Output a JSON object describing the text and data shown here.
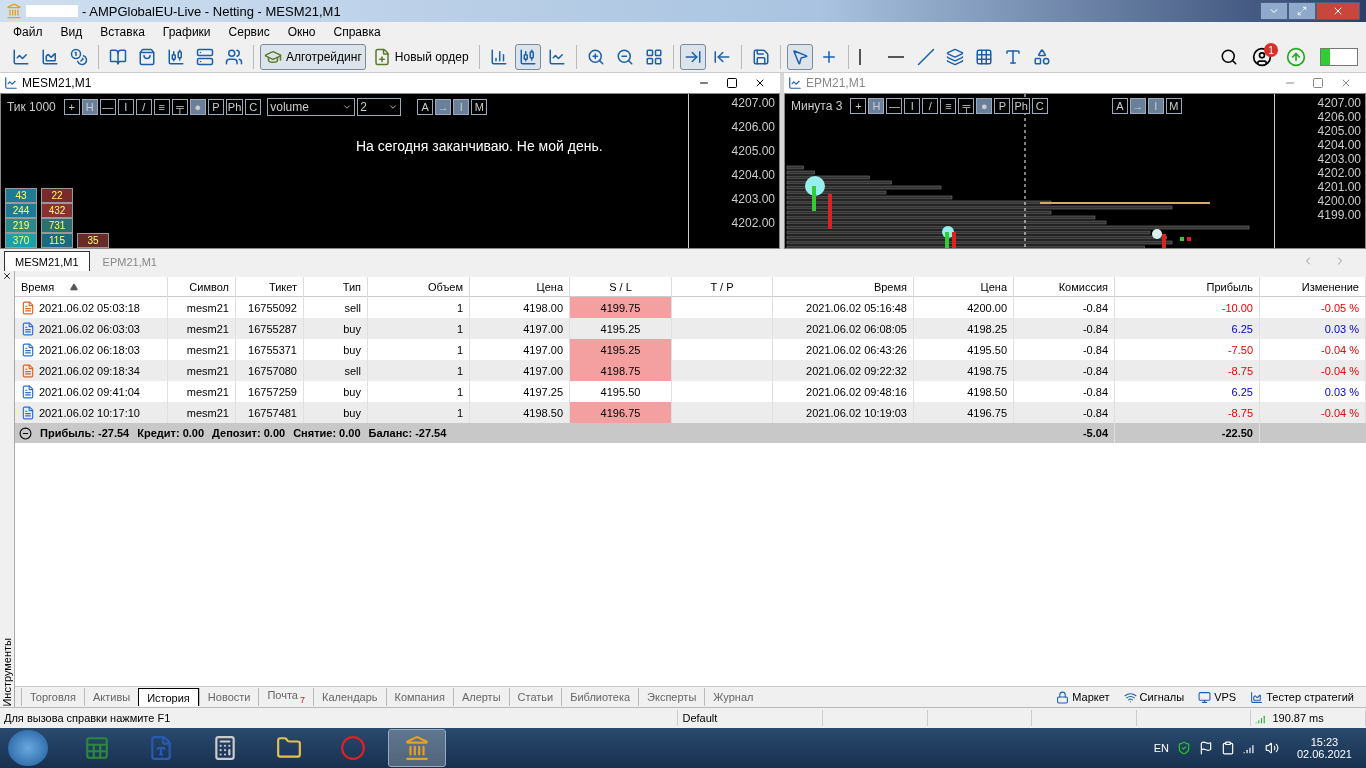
{
  "window": {
    "title": "- AMPGlobalEU-Live - Netting - MESM21,M1"
  },
  "menu": [
    "Файл",
    "Вид",
    "Вставка",
    "Графики",
    "Сервис",
    "Окно",
    "Справка"
  ],
  "toolbar": [
    {
      "kind": "button",
      "selected": false
    },
    {
      "kind": "button",
      "selected": false
    },
    {
      "kind": "button",
      "selected": false
    },
    {
      "kind": "separator"
    },
    {
      "kind": "button",
      "selected": false
    },
    {
      "kind": "button",
      "selected": false
    },
    {
      "kind": "button",
      "selected": false
    },
    {
      "kind": "button",
      "selected": false
    },
    {
      "kind": "button",
      "selected": false
    },
    {
      "kind": "separator"
    },
    {
      "kind": "labeled",
      "label": "Алготрейдинг",
      "selected": true
    },
    {
      "kind": "labeled",
      "label": "Новый ордер",
      "selected": false
    },
    {
      "kind": "separator"
    },
    {
      "kind": "button",
      "selected": false
    },
    {
      "kind": "button",
      "selected": true
    },
    {
      "kind": "button",
      "selected": false
    },
    {
      "kind": "separator"
    },
    {
      "kind": "button",
      "selected": false
    },
    {
      "kind": "button",
      "selected": false
    },
    {
      "kind": "button",
      "selected": false
    },
    {
      "kind": "separator"
    },
    {
      "kind": "button",
      "selected": true
    },
    {
      "kind": "button",
      "selected": false
    },
    {
      "kind": "separator"
    },
    {
      "kind": "button",
      "selected": false
    },
    {
      "kind": "separator"
    },
    {
      "kind": "button",
      "selected": true
    },
    {
      "kind": "button",
      "selected": false
    },
    {
      "kind": "separator"
    },
    {
      "kind": "button",
      "selected": false
    },
    {
      "kind": "button",
      "selected": false
    },
    {
      "kind": "button",
      "selected": false
    },
    {
      "kind": "button",
      "selected": false
    },
    {
      "kind": "button",
      "selected": false
    },
    {
      "kind": "button",
      "selected": false
    },
    {
      "kind": "button",
      "selected": false
    }
  ],
  "notifications": {
    "badge": "1"
  },
  "charts": [
    {
      "title": "MESM21,M1",
      "active": true,
      "label": "Тик 1000",
      "tools": [
        "+",
        "H",
        "—",
        "I",
        "/",
        "≡",
        "╤",
        "●",
        "P",
        "Ph",
        "C"
      ],
      "indicator": "volume",
      "period": "2",
      "modes": [
        "A",
        "→",
        "I",
        "M"
      ],
      "message": "На сегодня заканчиваю. Не мой день.",
      "prices": [
        "4207.00",
        "4206.00",
        "4205.00",
        "4204.00",
        "4203.00",
        "4202.00"
      ],
      "clusters": [
        [
          {
            "value": "43",
            "color": "#1f7a96"
          },
          {
            "value": "244",
            "color": "#1f7a96"
          },
          {
            "value": "219",
            "color": "#2a8a8a"
          },
          {
            "value": "370",
            "color": "#1aa0a8"
          }
        ],
        [
          {
            "value": "22",
            "color": "#7a2a2a"
          },
          {
            "value": "432",
            "color": "#8a3030"
          },
          {
            "value": "731",
            "color": "#2a7070"
          },
          {
            "value": "115",
            "color": "#1a6a80"
          }
        ],
        [
          {
            "value": "35",
            "color": "#6a2a2a"
          }
        ]
      ]
    },
    {
      "title": "EPM21,M1",
      "active": false,
      "label": "Минута 3",
      "tools": [
        "+",
        "H",
        "—",
        "I",
        "/",
        "≡",
        "╤",
        "●",
        "P",
        "Ph",
        "C"
      ],
      "modes": [
        "A",
        "→",
        "I",
        "M"
      ],
      "prices": [
        "4207.00",
        "4206.00",
        "4205.00",
        "4204.00",
        "4203.00",
        "4202.00",
        "4201.00",
        "4200.00",
        "4199.00"
      ]
    }
  ],
  "chart_tabs": [
    {
      "label": "MESM21,M1",
      "selected": true
    },
    {
      "label": "EPM21,M1",
      "selected": false
    }
  ],
  "table": {
    "columns": [
      "Время",
      "Символ",
      "Тикет",
      "Тип",
      "Объем",
      "Цена",
      "S / L",
      "T / P",
      "Время",
      "Цена",
      "Комиссия",
      "Прибыль",
      "Изменение"
    ],
    "rows": [
      {
        "kind": "sell",
        "cells": [
          "2021.06.02 05:03:18",
          "mesm21",
          "16755092",
          "sell",
          "1",
          "4198.00",
          "4199.75",
          "",
          "2021.06.02 05:16:48",
          "4200.00",
          "-0.84",
          "-10.00",
          "-0.05 %"
        ],
        "sl_hit": true,
        "loss": true
      },
      {
        "kind": "buy",
        "cells": [
          "2021.06.02 06:03:03",
          "mesm21",
          "16755287",
          "buy",
          "1",
          "4197.00",
          "4195.25",
          "",
          "2021.06.02 06:08:05",
          "4198.25",
          "-0.84",
          "6.25",
          "0.03 %"
        ],
        "sl_hit": false,
        "loss": false
      },
      {
        "kind": "buy",
        "cells": [
          "2021.06.02 06:18:03",
          "mesm21",
          "16755371",
          "buy",
          "1",
          "4197.00",
          "4195.25",
          "",
          "2021.06.02 06:43:26",
          "4195.50",
          "-0.84",
          "-7.50",
          "-0.04 %"
        ],
        "sl_hit": true,
        "loss": true
      },
      {
        "kind": "sell",
        "cells": [
          "2021.06.02 09:18:34",
          "mesm21",
          "16757080",
          "sell",
          "1",
          "4197.00",
          "4198.75",
          "",
          "2021.06.02 09:22:32",
          "4198.75",
          "-0.84",
          "-8.75",
          "-0.04 %"
        ],
        "sl_hit": true,
        "loss": true
      },
      {
        "kind": "buy",
        "cells": [
          "2021.06.02 09:41:04",
          "mesm21",
          "16757259",
          "buy",
          "1",
          "4197.25",
          "4195.50",
          "",
          "2021.06.02 09:48:16",
          "4198.50",
          "-0.84",
          "6.25",
          "0.03 %"
        ],
        "sl_hit": false,
        "loss": false
      },
      {
        "kind": "buy",
        "cells": [
          "2021.06.02 10:17:10",
          "mesm21",
          "16757481",
          "buy",
          "1",
          "4198.50",
          "4196.75",
          "",
          "2021.06.02 10:19:03",
          "4196.75",
          "-0.84",
          "-8.75",
          "-0.04 %"
        ],
        "sl_hit": true,
        "loss": true
      }
    ],
    "summary": {
      "items": [
        "Прибыль: -27.54",
        "Кредит: 0.00",
        "Депозит: 0.00",
        "Снятие: 0.00",
        "Баланс: -27.54"
      ],
      "commission": "-5.04",
      "profit": "-22.50"
    }
  },
  "side_label": "Инструменты",
  "bottom_tabs": [
    {
      "label": "Торговля",
      "selected": false
    },
    {
      "label": "Активы",
      "selected": false
    },
    {
      "label": "История",
      "selected": true
    },
    {
      "label": "Новости",
      "selected": false
    },
    {
      "label": "Почта",
      "badge": "7",
      "selected": false
    },
    {
      "label": "Календарь",
      "selected": false
    },
    {
      "label": "Компания",
      "selected": false
    },
    {
      "label": "Алерты",
      "selected": false
    },
    {
      "label": "Статьи",
      "selected": false
    },
    {
      "label": "Библиотека",
      "selected": false
    },
    {
      "label": "Эксперты",
      "selected": false
    },
    {
      "label": "Журнал",
      "selected": false
    }
  ],
  "links": [
    "Маркет",
    "Сигналы",
    "VPS",
    "Тестер стратегий"
  ],
  "status": {
    "help": "Для вызова справки нажмите F1",
    "profile": "Default",
    "ping": "190.87 ms"
  },
  "taskbar": {
    "apps": [
      {
        "selected": false
      },
      {
        "selected": false
      },
      {
        "selected": false
      },
      {
        "selected": false
      },
      {
        "selected": false
      },
      {
        "selected": true
      }
    ],
    "language": "EN",
    "time": "15:23",
    "date": "02.06.2021"
  }
}
